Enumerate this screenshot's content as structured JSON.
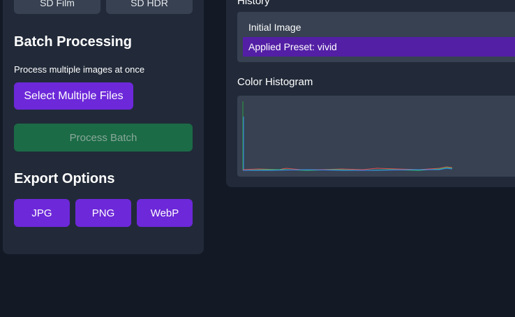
{
  "presets": [
    {
      "label": "SD Film"
    },
    {
      "label": "SD HDR"
    }
  ],
  "batch": {
    "title": "Batch Processing",
    "description": "Process multiple images at once",
    "select_label": "Select Multiple Files",
    "process_label": "Process Batch"
  },
  "export": {
    "title": "Export Options",
    "formats": [
      "JPG",
      "PNG",
      "WebP"
    ]
  },
  "history": {
    "title": "History",
    "items": [
      {
        "label": "Initial Image",
        "active": false
      },
      {
        "label": "Applied Preset: vivid",
        "active": true
      }
    ]
  },
  "histogram": {
    "title": "Color Histogram"
  },
  "colors": {
    "background": "#141926",
    "panel": "#222a39",
    "accent_purple": "#6d28d9",
    "active_history": "#531fa5",
    "batch_green": "#1b6b46"
  }
}
